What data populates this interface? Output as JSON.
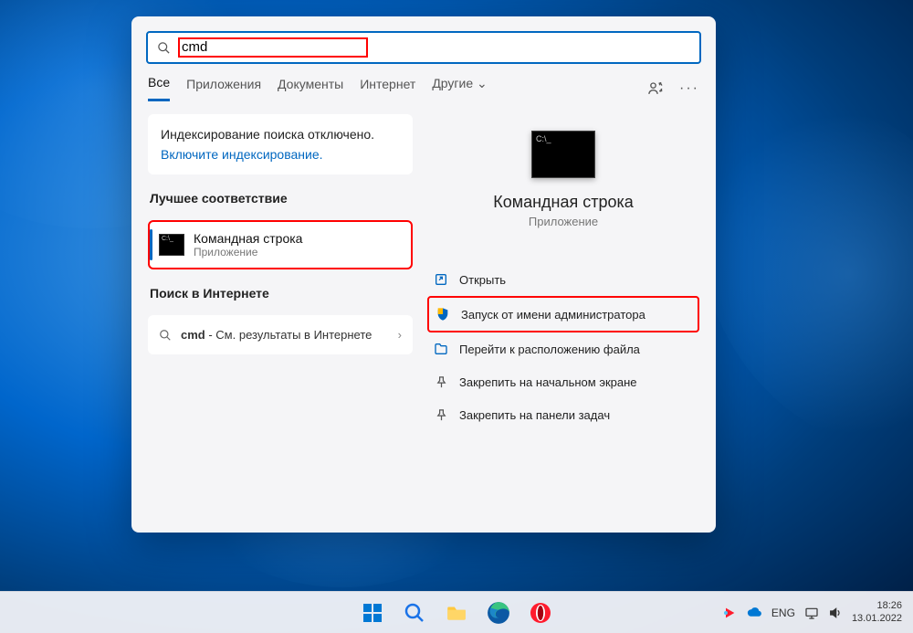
{
  "search": {
    "value": "cmd"
  },
  "tabs": [
    "Все",
    "Приложения",
    "Документы",
    "Интернет",
    "Другие"
  ],
  "active_tab_index": 0,
  "indexing": {
    "message": "Индексирование поиска отключено.",
    "link": "Включите индексирование."
  },
  "sections": {
    "best_match": "Лучшее соответствие",
    "web_search": "Поиск в Интернете"
  },
  "best_match_result": {
    "title": "Командная строка",
    "subtitle": "Приложение"
  },
  "web_result": {
    "term": "cmd",
    "suffix": " - См. результаты в Интернете"
  },
  "preview": {
    "title": "Командная строка",
    "subtitle": "Приложение",
    "actions": {
      "open": "Открыть",
      "run_admin": "Запуск от имени администратора",
      "open_location": "Перейти к расположению файла",
      "pin_start": "Закрепить на начальном экране",
      "pin_taskbar": "Закрепить на панели задач"
    }
  },
  "tray": {
    "lang": "ENG",
    "time": "18:26",
    "date": "13.01.2022"
  }
}
